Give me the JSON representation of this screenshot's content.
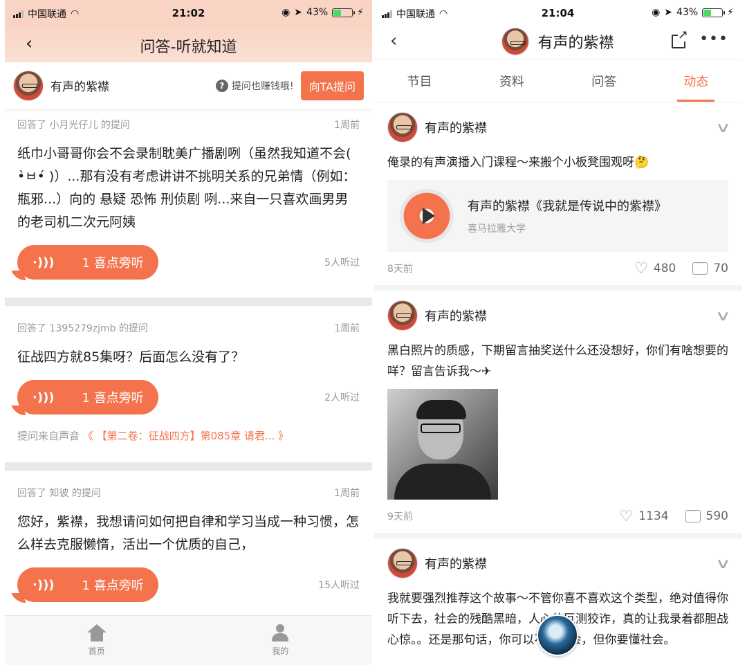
{
  "status_left": {
    "carrier": "中国联通",
    "time": "21:02",
    "battery": "43%"
  },
  "status_right": {
    "carrier": "中国联通",
    "time": "21:04",
    "battery": "43%"
  },
  "left": {
    "title": "问答-听就知道",
    "back_icon": "‹",
    "user": "有声的紫襟",
    "hint": "提问也赚钱哦!",
    "ask_button": "向TA提问",
    "items": [
      {
        "meta_left": "回答了 小月光仔儿 的提问",
        "time": "1周前",
        "question": "纸巾小哥哥你会不会录制耽美广播剧咧（虽然我知道不会( •̀ㅂ•́ )）...那有没有考虑讲讲不挑明关系的兄弟情（例如：瓶邪...）向的 悬疑 恐怖 刑侦剧 咧...来自一只喜欢画男男的老司机二次元阿姨",
        "listen": "1 喜点旁听",
        "heard": "5人听过"
      },
      {
        "meta_left": "回答了 1395279zjmb 的提问",
        "time": "1周前",
        "question": "征战四方就85集呀？后面怎么没有了？",
        "listen": "1 喜点旁听",
        "heard": "2人听过",
        "source_prefix": "提问来自声音",
        "source_link": "《 【第二卷：征战四方】第085章 请君... 》"
      },
      {
        "meta_left": "回答了 知彼 的提问",
        "time": "1周前",
        "question": "您好，紫襟，我想请问如何把自律和学习当成一种习惯，怎么样去克服懒惰，活出一个优质的自己，",
        "listen": "1 喜点旁听",
        "heard": "15人听过"
      }
    ],
    "tabs": [
      {
        "label": "首页",
        "icon": "home-icon"
      },
      {
        "label": "我的",
        "icon": "user-icon"
      }
    ]
  },
  "right": {
    "title": "有声的紫襟",
    "tabs": [
      "节目",
      "资料",
      "问答",
      "动态"
    ],
    "active_tab": "动态",
    "posts": [
      {
        "author": "有声的紫襟",
        "text": "俺录的有声演播入门课程～来搬个小板凳围观呀🤔",
        "card_title": "有声的紫襟《我就是传说中的紫襟》",
        "card_sub": "喜马拉雅大学",
        "time": "8天前",
        "likes": "480",
        "comments": "70"
      },
      {
        "author": "有声的紫襟",
        "text": "黑白照片的质感，下期留言抽奖送什么还没想好，你们有啥想要的咩？留言告诉我～✈",
        "time": "9天前",
        "likes": "1134",
        "comments": "590"
      },
      {
        "author": "有声的紫襟",
        "text": "我就要强烈推荐这个故事～不管你喜不喜欢这个类型，绝对值得你听下去，社会的残酷黑暗，人心的叵测狡诈，真的让我录着都胆战心惊。。还是那句话，你可以不混社会，但你要懂社会。"
      }
    ]
  },
  "colors": {
    "accent": "#f4734d",
    "header_bg": "#f9d4c4"
  }
}
